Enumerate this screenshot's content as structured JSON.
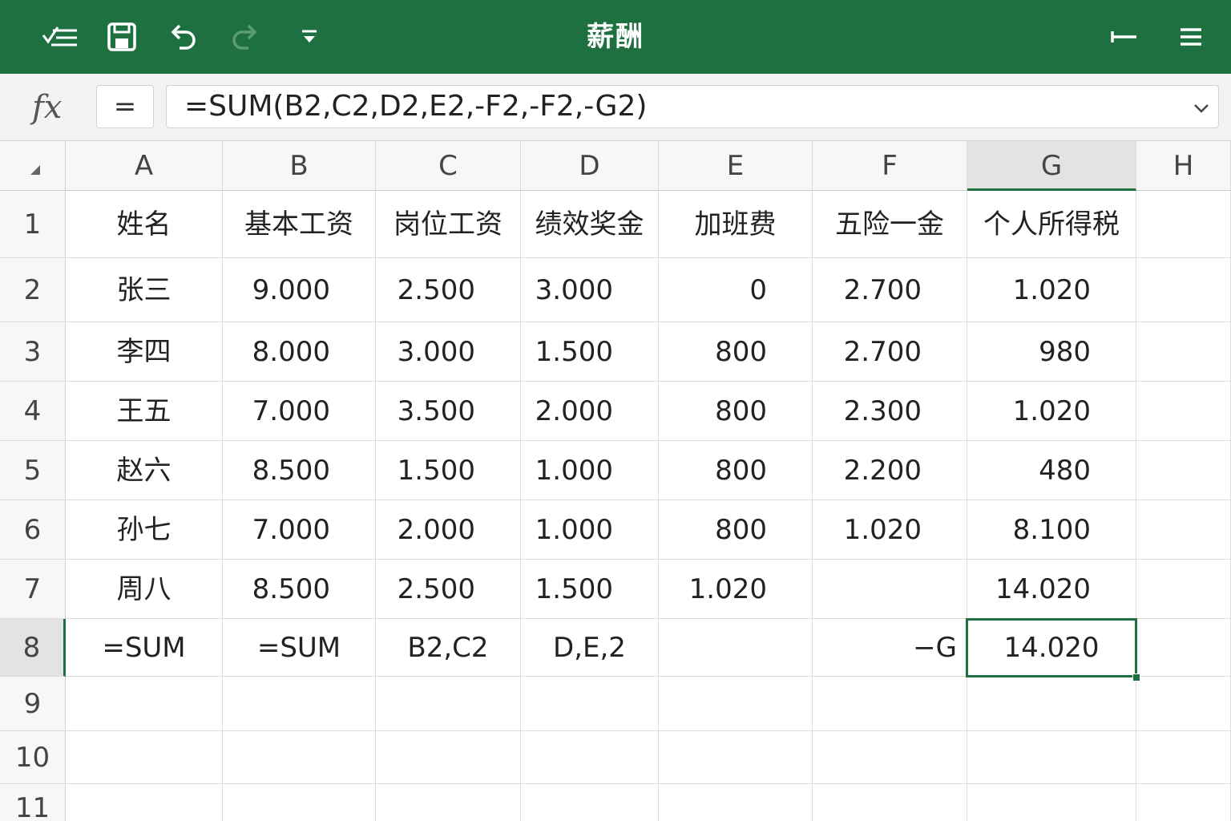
{
  "toolbar": {
    "title": "薪酬",
    "icons": [
      "menu-check-icon",
      "save-icon",
      "undo-icon",
      "redo-icon",
      "dropdown-icon",
      "back-arrow-icon",
      "hamburger-menu-icon"
    ]
  },
  "colors": {
    "accent": "#1f7040",
    "selected_header": "#e3e3e3",
    "gridline": "#dcdcdc"
  },
  "formula_bar": {
    "fx_label": "fx",
    "equals_label": "=",
    "formula": "=SUM(B2,C2,D2,E2,-F2,-F2,-G2)"
  },
  "sheet": {
    "columns": [
      "A",
      "B",
      "C",
      "D",
      "E",
      "F",
      "G",
      "H"
    ],
    "row_numbers": [
      "1",
      "2",
      "3",
      "4",
      "5",
      "6",
      "7",
      "8",
      "9",
      "10",
      "11"
    ],
    "selected_cell": "G8",
    "rows": [
      [
        "姓名",
        "基本工资",
        "岗位工资",
        "绩效奖金",
        "加班费",
        "五险一金",
        "个人所得税"
      ],
      [
        "张三",
        "9.000",
        "2.500",
        "3.000",
        "0",
        "2.700",
        "1.020"
      ],
      [
        "李四",
        "8.000",
        "3.000",
        "1.500",
        "800",
        "2.700",
        "980"
      ],
      [
        "王五",
        "7.000",
        "3.500",
        "2.000",
        "800",
        "2.300",
        "1.020"
      ],
      [
        "赵六",
        "8.500",
        "1.500",
        "1.000",
        "800",
        "2.200",
        "480"
      ],
      [
        "孙七",
        "7.000",
        "2.000",
        "1.000",
        "800",
        "1.020",
        "8.100"
      ],
      [
        "周八",
        "8.500",
        "2.500",
        "1.500",
        "1.020",
        "",
        "14.020"
      ],
      [
        "=SUM",
        "=SUM",
        "B2,C2",
        "D,E,2",
        "",
        "−G",
        "14.020"
      ]
    ]
  }
}
